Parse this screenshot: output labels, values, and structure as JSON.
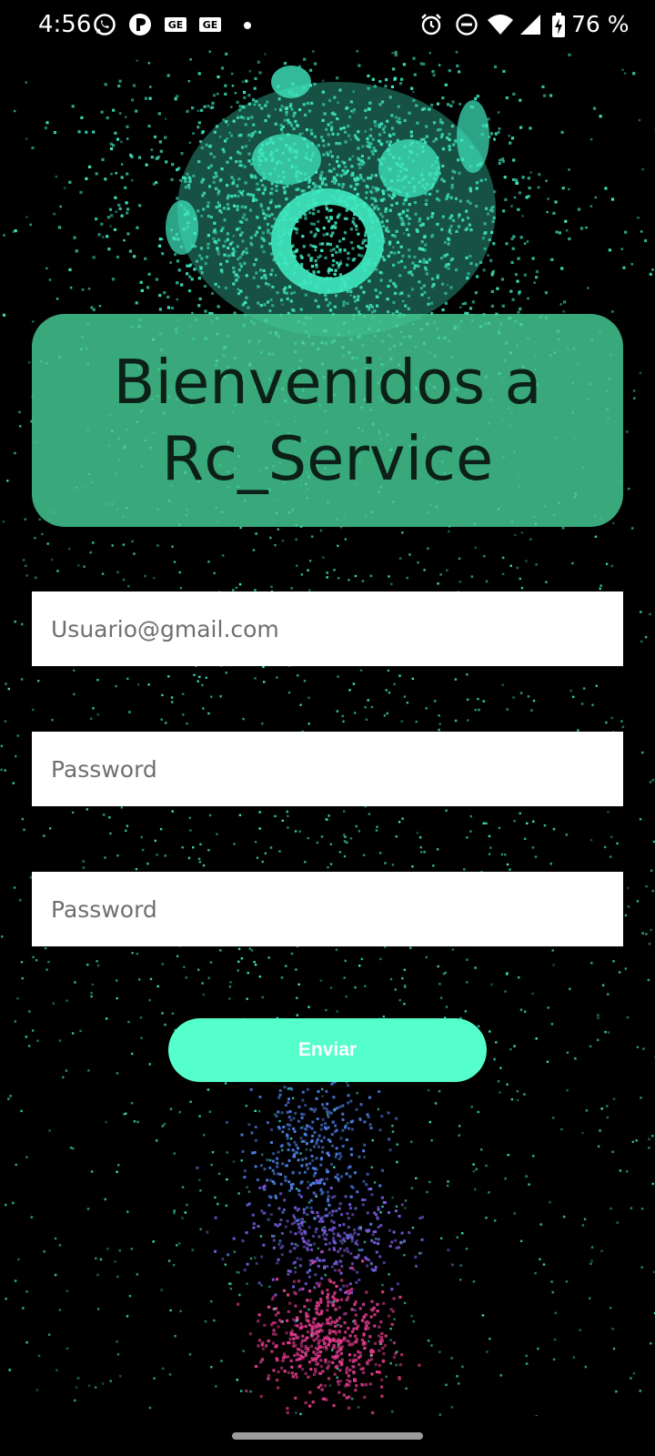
{
  "status_bar": {
    "time": "4:56",
    "battery_percent": "76 %",
    "battery_level": 0.76,
    "icons": [
      "whatsapp-icon",
      "app-icon",
      "ge-notification-icon",
      "ge-notification-icon",
      "notification-dot",
      "alarm-icon",
      "do-not-disturb-icon",
      "wifi-icon",
      "signal-icon",
      "battery-charging-icon"
    ]
  },
  "welcome": {
    "title": "Bienvenidos a\nRc_Service"
  },
  "form": {
    "email_placeholder": "Usuario@gmail.com",
    "password_placeholder": "Password",
    "confirm_password_placeholder": "Password",
    "submit_label": "Enviar"
  },
  "colors": {
    "card": "#46cd96",
    "button": "#55ffcc",
    "art_primary": "#3fe8c0",
    "art_blue": "#4f7fe8",
    "art_pink": "#e03a8c"
  }
}
